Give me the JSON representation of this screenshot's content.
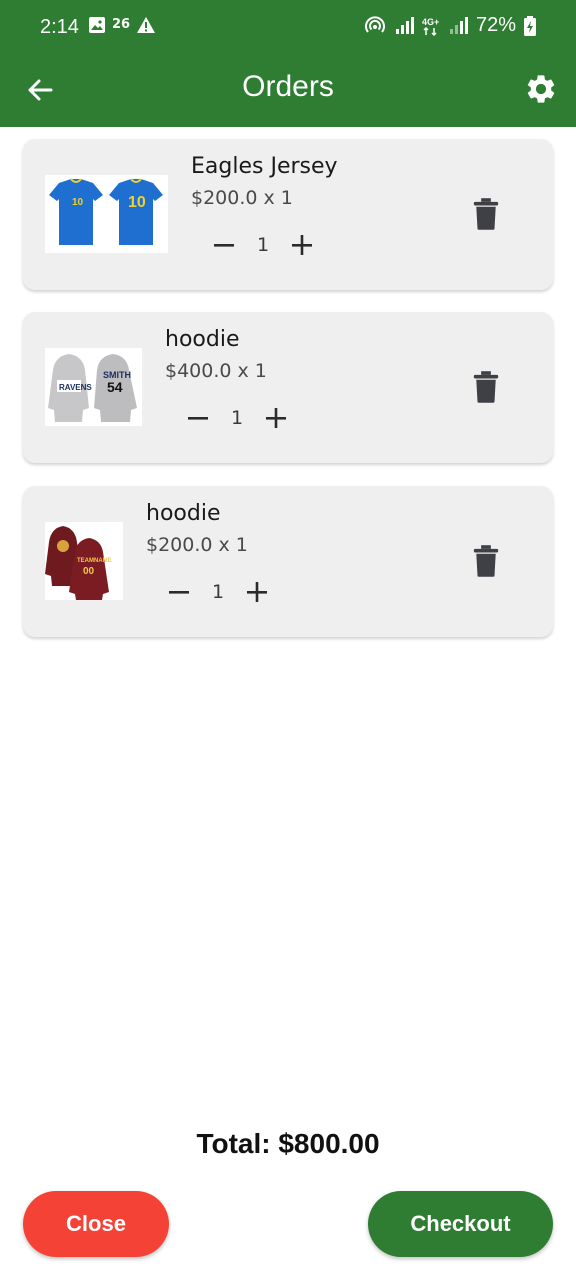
{
  "status_bar": {
    "time": "2:14",
    "notif_badge": "26",
    "battery": "72%"
  },
  "app_bar": {
    "title": "Orders",
    "back_icon": "arrow-left-icon",
    "settings_icon": "gear-icon"
  },
  "orders": [
    {
      "name": "Eagles Jersey",
      "price": "$200.0 x 1",
      "quantity": "1",
      "image": "blue-jersey"
    },
    {
      "name": "hoodie",
      "price": "$400.0 x 1",
      "quantity": "1",
      "image": "grey-hoodie"
    },
    {
      "name": "hoodie",
      "price": "$200.0 x 1",
      "quantity": "1",
      "image": "maroon-hoodie"
    }
  ],
  "summary": {
    "total": "Total: $800.00"
  },
  "actions": {
    "close_label": "Close",
    "checkout_label": "Checkout"
  },
  "colors": {
    "primary": "#2e7d32",
    "danger": "#f44336",
    "card": "#efefef"
  }
}
